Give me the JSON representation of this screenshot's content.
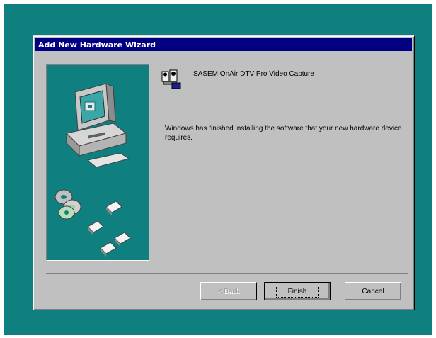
{
  "window": {
    "title": "Add New Hardware Wizard"
  },
  "wizard": {
    "device_name": "SASEM OnAir DTV Pro Video Capture",
    "message": "Windows has finished installing the software that your new hardware device requires."
  },
  "buttons": {
    "back": "< Back",
    "finish": "Finish",
    "cancel": "Cancel"
  },
  "colors": {
    "desktop": "#0f807f",
    "titlebar": "#000080",
    "face": "#c0c0c0"
  },
  "icons": {
    "illustration": "computer-with-cds-icon",
    "device": "camera-device-icon"
  }
}
